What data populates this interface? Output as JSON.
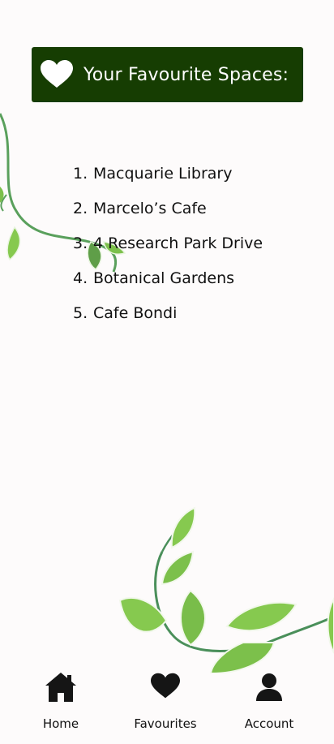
{
  "header": {
    "title": "Your Favourite Spaces:",
    "icon": "heart-icon"
  },
  "favourites": [
    {
      "number": "1.",
      "name": "Macquarie Library"
    },
    {
      "number": "2.",
      "name": "Marcelo’s Cafe"
    },
    {
      "number": "3.",
      "name": "4 Research Park Drive"
    },
    {
      "number": "4.",
      "name": "Botanical Gardens"
    },
    {
      "number": "5.",
      "name": "Cafe Bondi"
    }
  ],
  "nav": {
    "home": {
      "label": "Home",
      "icon": "home-icon"
    },
    "favourites": {
      "label": "Favourites",
      "icon": "heart-icon"
    },
    "account": {
      "label": "Account",
      "icon": "person-icon"
    }
  },
  "colors": {
    "banner": "#163d02",
    "background": "#fdfbfb",
    "leaf": "#7cc04b",
    "vine": "#4a8f5a"
  }
}
